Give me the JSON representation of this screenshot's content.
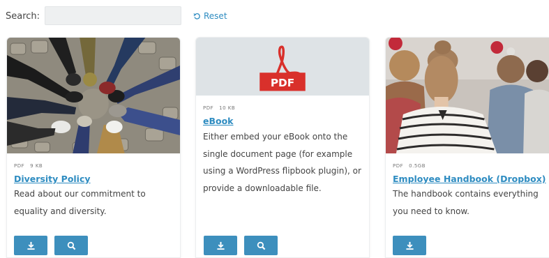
{
  "search": {
    "label": "Search:",
    "value": "",
    "placeholder": ""
  },
  "reset": {
    "label": "Reset"
  },
  "cards": [
    {
      "file_type": "PDF",
      "file_size": "9 KB",
      "title": "Diversity Policy",
      "description": "Read about our commitment to equality and diversity.",
      "thumbnail": "diversity-feet-circle-photo",
      "actions": [
        "download-icon",
        "search-icon"
      ]
    },
    {
      "file_type": "PDF",
      "file_size": "10 KB",
      "title": "eBook",
      "description": "Either embed your eBook onto the single document page (for example using a WordPress flipbook plugin), or provide a downloadable file.",
      "thumbnail": "pdf-file-icon",
      "actions": [
        "download-icon",
        "search-icon"
      ]
    },
    {
      "file_type": "PDF",
      "file_size": "0.5GB",
      "title": "Employee Handbook (Dropbox)",
      "description": "The handbook contains everything you need to know.",
      "thumbnail": "people-audience-photo",
      "actions": [
        "download-icon"
      ]
    }
  ],
  "colors": {
    "accent": "#2e8cc1",
    "button": "#3d8fbd",
    "doc_thumb_bg": "#dee3e6",
    "pdf_red": "#d9302b"
  }
}
